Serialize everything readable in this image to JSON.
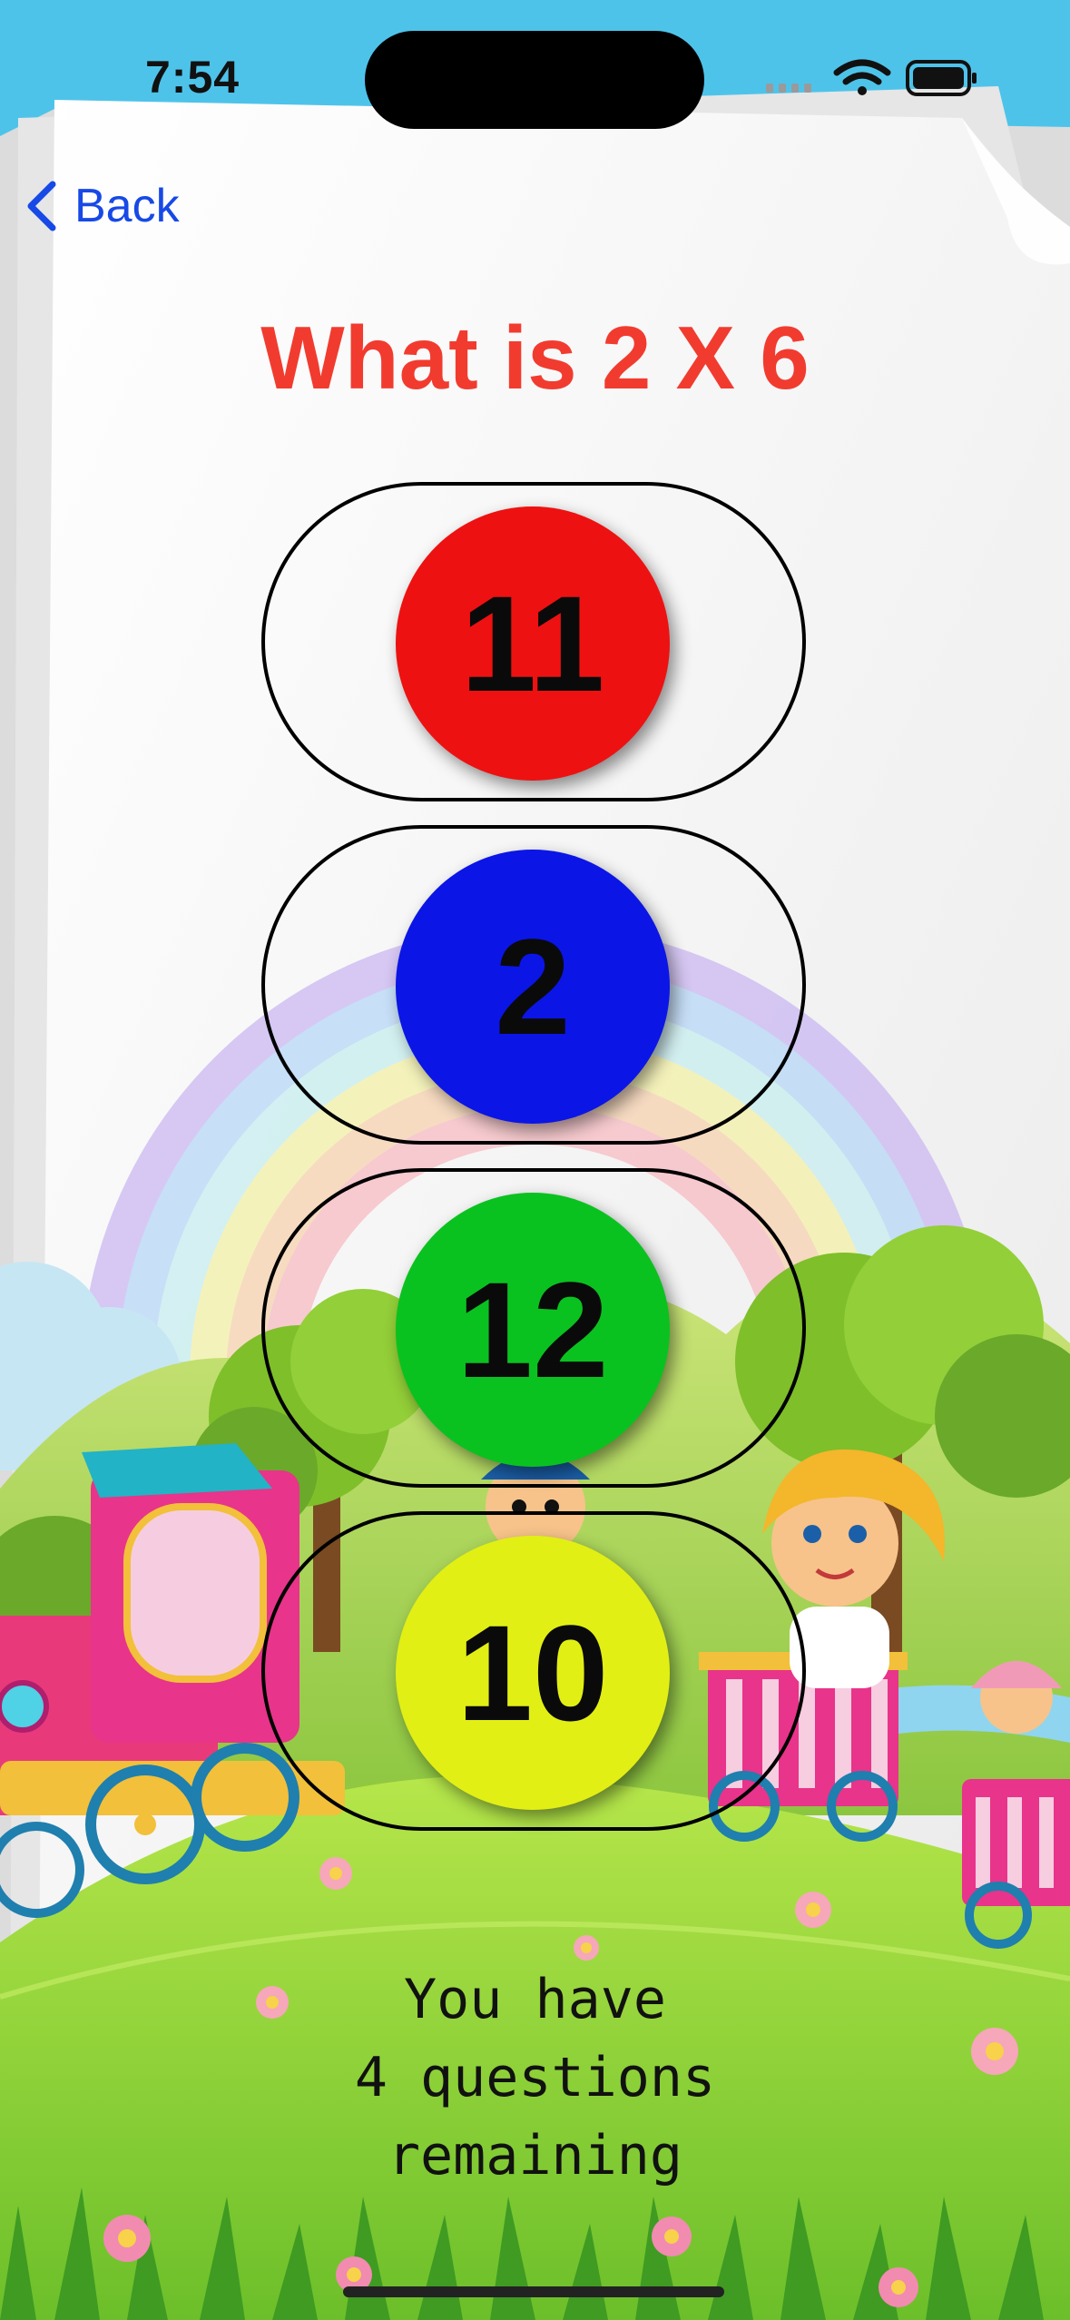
{
  "status_bar": {
    "time": "7:54",
    "icons": [
      "cellular-signal-icon",
      "wifi-icon",
      "battery-icon"
    ]
  },
  "nav": {
    "back_label": "Back",
    "back_icon": "chevron-left-icon"
  },
  "question": {
    "text": "What is 2 X 6"
  },
  "answers": [
    {
      "label": "11",
      "color": "#ee1111"
    },
    {
      "label": "2",
      "color": "#0b15e6"
    },
    {
      "label": "12",
      "color": "#0ac21f"
    },
    {
      "label": "10",
      "color": "#e2ef14"
    }
  ],
  "remaining": {
    "lines": [
      "You have",
      "4 questions",
      "remaining"
    ]
  },
  "colors": {
    "accent_back": "#1749e6",
    "question_text": "#f23b2f",
    "sky": "#4ec3ea",
    "paper": "#f1f1f1",
    "grass": "#8fd23a"
  }
}
